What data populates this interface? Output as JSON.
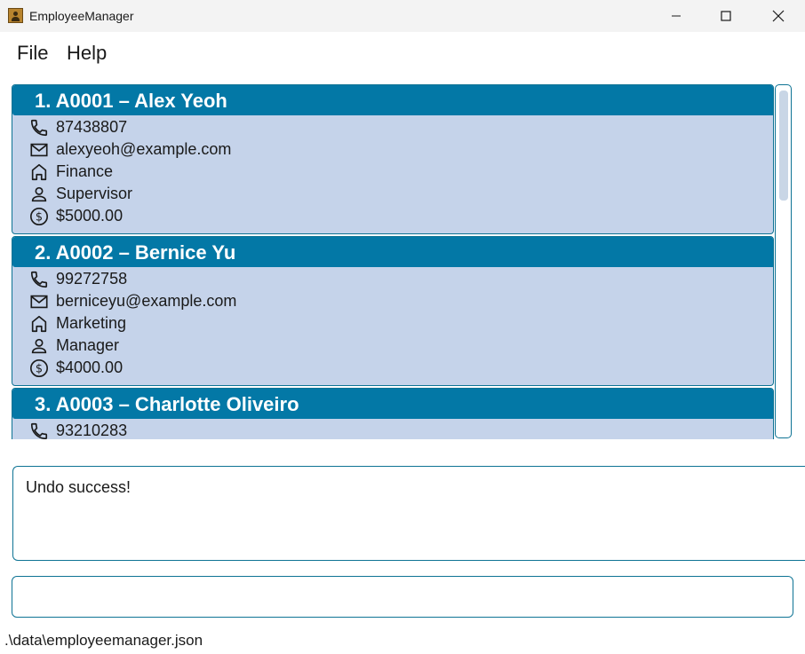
{
  "window": {
    "title": "EmployeeManager"
  },
  "menu": {
    "file": "File",
    "help": "Help"
  },
  "employees": [
    {
      "title": "1.  A0001 – Alex Yeoh",
      "phone": "87438807",
      "email": "alexyeoh@example.com",
      "department": "Finance",
      "role": "Supervisor",
      "salary": "$5000.00"
    },
    {
      "title": "2.  A0002 – Bernice Yu",
      "phone": "99272758",
      "email": "berniceyu@example.com",
      "department": "Marketing",
      "role": "Manager",
      "salary": "$4000.00"
    },
    {
      "title": "3.  A0003 – Charlotte Oliveiro",
      "phone": "93210283"
    }
  ],
  "result": {
    "message": "Undo success!"
  },
  "command": {
    "value": ""
  },
  "status": {
    "file_path": ".\\data\\employeemanager.json"
  },
  "icons": {
    "phone": "phone-icon",
    "email": "mail-icon",
    "department": "building-icon",
    "role": "person-icon",
    "salary": "dollar-icon"
  },
  "colors": {
    "card_header": "#0378a6",
    "card_body": "#c5d3ea",
    "border": "#0e7394"
  }
}
